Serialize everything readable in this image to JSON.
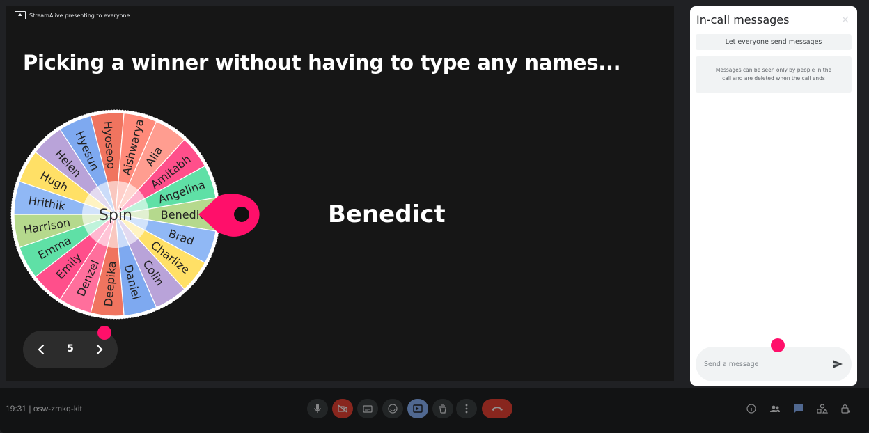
{
  "presenter": {
    "label": "StreamAlive presenting to everyone"
  },
  "slide": {
    "title": "Picking a winner without having to type any names...",
    "winner": "Benedict",
    "spin_label": "Spin",
    "wheel_names": [
      "Benedict",
      "Brad",
      "Charlize",
      "Colin",
      "Daniel",
      "Deepika",
      "Denzel",
      "Emily",
      "Emma",
      "Harrison",
      "Hrithik",
      "Hugh",
      "Helen",
      "Hyesun",
      "Hyoseop",
      "Aishwarya",
      "Alia",
      "Amitabh",
      "Angelina"
    ],
    "wheel_colors": [
      "#b5d98d",
      "#90b8f5",
      "#ffe066",
      "#b9a3d9",
      "#7ea9f0",
      "#f0745f",
      "#ff6f9c",
      "#ff4f8b",
      "#5fe0a6",
      "#b5d98d",
      "#90b8f5",
      "#ffe066",
      "#b9a3d9",
      "#7ea9f0",
      "#f0745f",
      "#ff8a7a",
      "#ff9d90",
      "#ff4f8b",
      "#5fe0a6"
    ],
    "pointer_color": "#ff0f6a"
  },
  "pager": {
    "page": "5"
  },
  "chat": {
    "title": "In-call messages",
    "toggle_label": "Let everyone send messages",
    "notice": "Messages can be seen only by people in the call and are deleted when the call ends",
    "input_placeholder": "Send a message",
    "accent": "#ff0f6a"
  },
  "meeting": {
    "info": "19:31  |  osw-zmkq-kit"
  },
  "controls": [
    {
      "name": "microphone-icon"
    },
    {
      "name": "camera-off-icon"
    },
    {
      "name": "captions-icon"
    },
    {
      "name": "emoji-icon"
    },
    {
      "name": "present-screen-icon"
    },
    {
      "name": "raise-hand-icon"
    },
    {
      "name": "more-options-icon"
    },
    {
      "name": "leave-call-icon"
    }
  ],
  "right_controls": [
    {
      "name": "meeting-details-icon"
    },
    {
      "name": "people-icon"
    },
    {
      "name": "chat-icon"
    },
    {
      "name": "activities-icon"
    },
    {
      "name": "host-controls-icon"
    }
  ]
}
